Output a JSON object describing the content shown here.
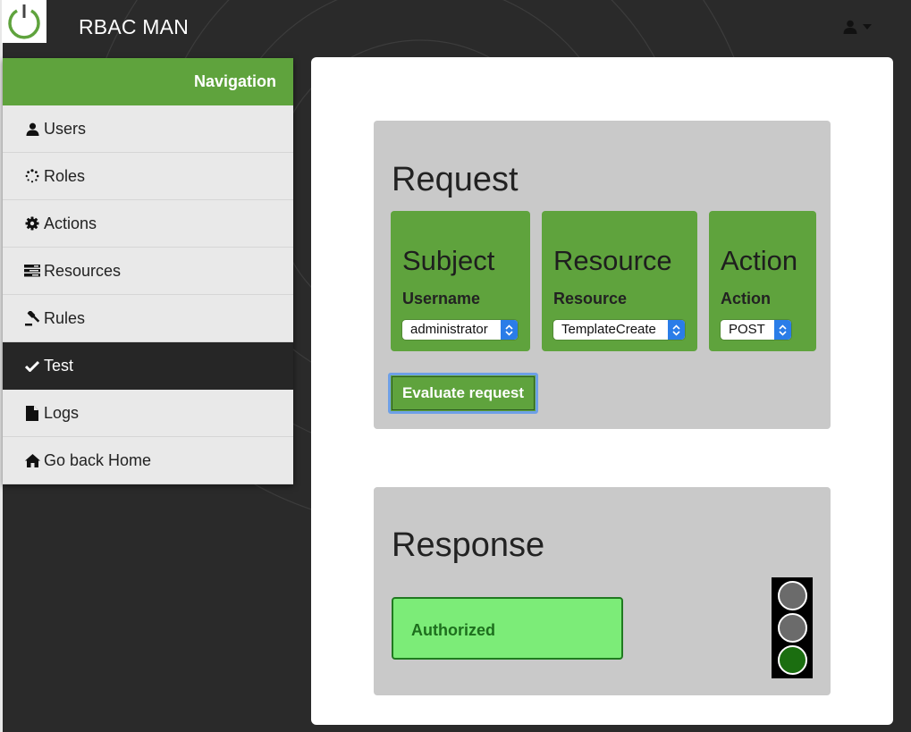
{
  "app": {
    "title": "RBAC MAN"
  },
  "topbar": {
    "user_icon": "user-icon",
    "dropdown_icon": "caret-down-icon"
  },
  "sidebar": {
    "header": "Navigation",
    "items": [
      {
        "label": "Users",
        "icon": "user-icon",
        "active": false
      },
      {
        "label": "Roles",
        "icon": "spinner-icon",
        "active": false
      },
      {
        "label": "Actions",
        "icon": "gear-icon",
        "active": false
      },
      {
        "label": "Resources",
        "icon": "tasks-icon",
        "active": false
      },
      {
        "label": "Rules",
        "icon": "gavel-icon",
        "active": false
      },
      {
        "label": "Test",
        "icon": "check-icon",
        "active": true
      },
      {
        "label": "Logs",
        "icon": "file-icon",
        "active": false
      },
      {
        "label": "Go back Home",
        "icon": "home-icon",
        "active": false
      }
    ]
  },
  "request": {
    "title": "Request",
    "subject": {
      "title": "Subject",
      "label": "Username",
      "value": "administrator"
    },
    "resource": {
      "title": "Resource",
      "label": "Resource",
      "value": "TemplateCreate"
    },
    "action": {
      "title": "Action",
      "label": "Action",
      "value": "POST"
    },
    "evaluate_label": "Evaluate request"
  },
  "response": {
    "title": "Response",
    "status": "Authorized",
    "traffic_light": {
      "red": "off",
      "yellow": "off",
      "green": "on"
    }
  },
  "colors": {
    "accent_green": "#5fa33d",
    "authorized_bg": "#7cec78",
    "light_off": "#6b6b6b",
    "light_on": "#1b6e10",
    "select_blue": "#2a7de8"
  }
}
